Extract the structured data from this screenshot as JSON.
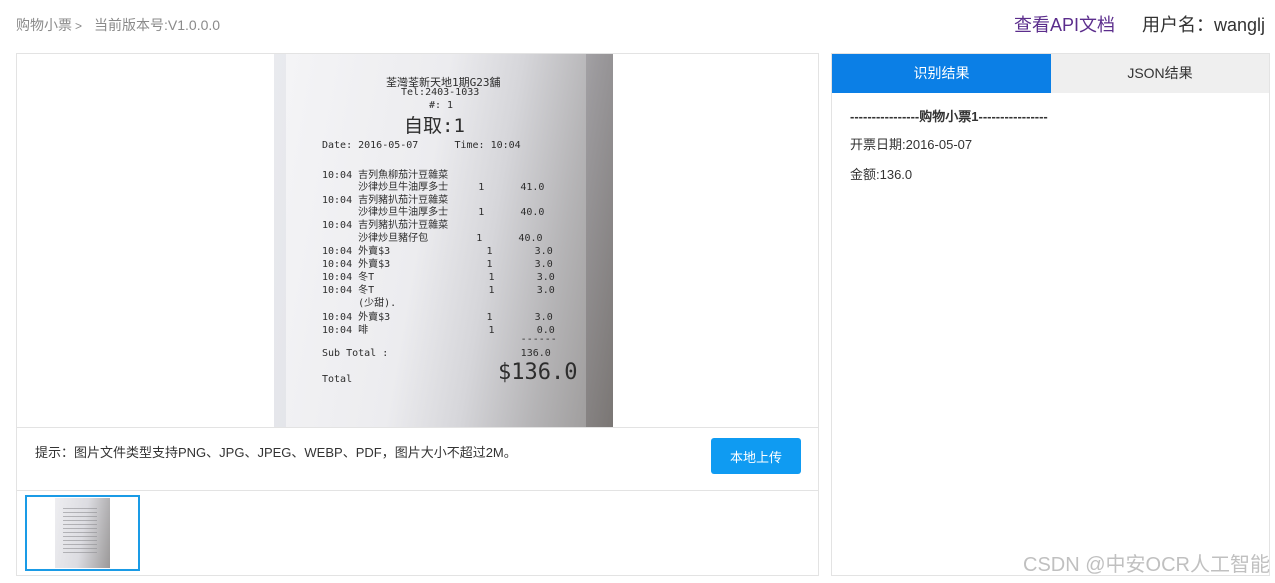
{
  "header": {
    "breadcrumb_home": "购物小票",
    "breadcrumb_sep": ">",
    "version": "当前版本号:V1.0.0.0",
    "api_link": "查看API文档",
    "user": "用户名：wanglj"
  },
  "receipt": {
    "lines": [
      "荃灣荃新天地1期G23舖",
      "Tel:2403-1033",
      "#: 1",
      "自取:1",
      "Date: 2016-05-07      Time: 10:04",
      "10:04 吉列魚柳茄汁豆雜菜",
      "      沙律炒旦牛油厚多士     1      41.0",
      "10:04 吉列豬扒茄汁豆雜菜",
      "      沙律炒旦牛油厚多士     1      40.0",
      "10:04 吉列豬扒茄汁豆雜菜",
      "      沙律炒旦豬仔包        1      40.0",
      "10:04 外賣$3                1       3.0",
      "10:04 外賣$3                1       3.0",
      "10:04 冬T                   1       3.0",
      "10:04 冬T                   1       3.0",
      "      (少甜).",
      "10:04 外賣$3                1       3.0",
      "10:04 啡                    1       0.0",
      "                                 ------",
      "Sub Total :                      136.0",
      "Total",
      "$136.0"
    ]
  },
  "tip": "提示：图片文件类型支持PNG、JPG、JPEG、WEBP、PDF，图片大小不超过2M。",
  "upload_button": "本地上传",
  "tabs": {
    "result": "识别结果",
    "json": "JSON结果"
  },
  "result": {
    "title": "----------------购物小票1----------------",
    "date_line": "开票日期:2016-05-07",
    "amount_line": "金额:136.0"
  },
  "watermark": "CSDN @中安OCR人工智能"
}
